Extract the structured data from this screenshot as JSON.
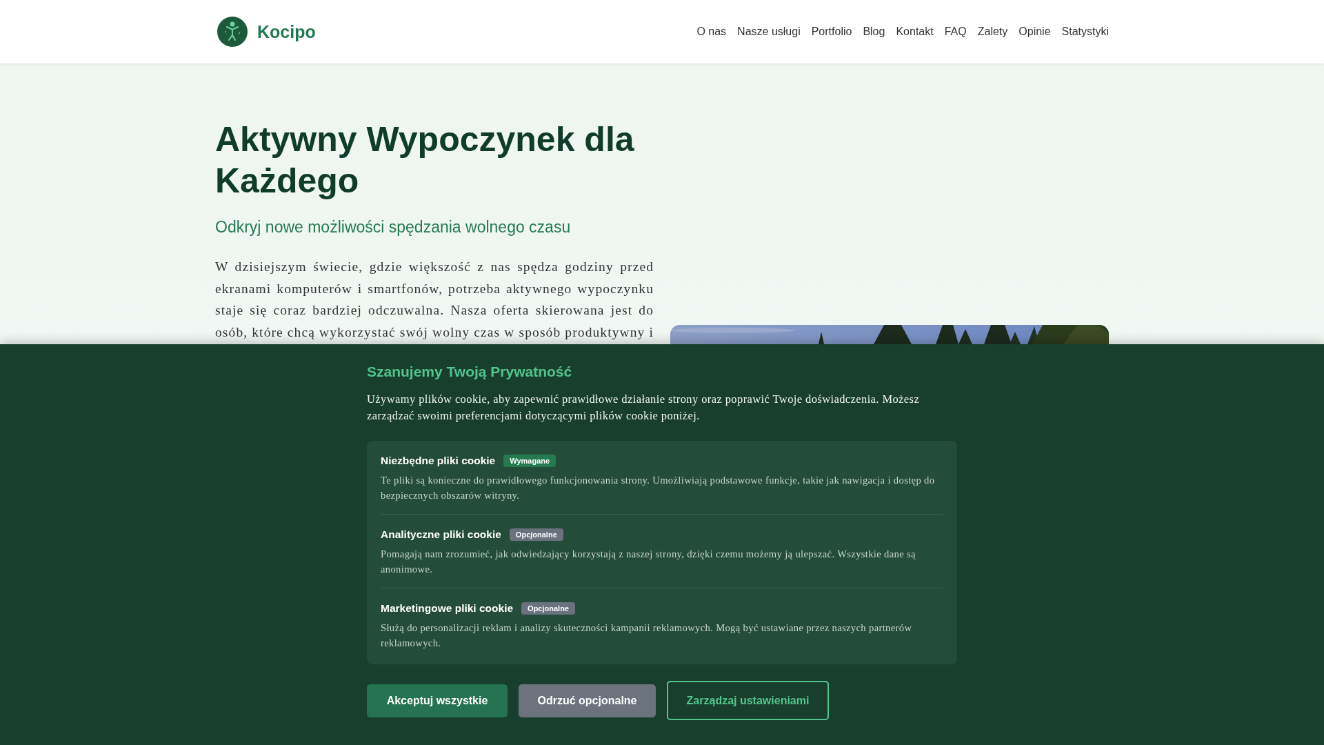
{
  "header": {
    "brand": "Kocipo",
    "nav": [
      {
        "label": "O nas"
      },
      {
        "label": "Nasze usługi"
      },
      {
        "label": "Portfolio"
      },
      {
        "label": "Blog"
      },
      {
        "label": "Kontakt"
      },
      {
        "label": "FAQ"
      },
      {
        "label": "Zalety"
      },
      {
        "label": "Opinie"
      },
      {
        "label": "Statystyki"
      }
    ]
  },
  "hero": {
    "title": "Aktywny Wypoczynek dla Każdego",
    "subtitle": "Odkryj nowe możliwości spędzania wolnego czasu",
    "paragraph": "W dzisiejszym świecie, gdzie większość z nas spędza godziny przed ekranami komputerów i smartfonów, potrzeba aktywnego wypoczynku staje się coraz bardziej odczuwalna. Nasza oferta skierowana jest do osób, które chcą wykorzystać swój wolny czas w sposób produktywny i"
  },
  "cookie_banner": {
    "title": "Szanujemy Twoją Prywatność",
    "text": "Używamy plików cookie, aby zapewnić prawidłowe działanie strony oraz poprawić Twoje doświadczenia. Możesz zarządzać swoimi preferencjami dotyczącymi plików cookie poniżej.",
    "categories": [
      {
        "name": "Niezbędne pliki cookie",
        "badge": "Wymagane",
        "kind": "required",
        "description": "Te pliki są konieczne do prawidłowego funkcjonowania strony. Umożliwiają podstawowe funkcje, takie jak nawigacja i dostęp do bezpiecznych obszarów witryny."
      },
      {
        "name": "Analityczne pliki cookie",
        "badge": "Opcjonalne",
        "kind": "optional",
        "description": "Pomagają nam zrozumieć, jak odwiedzający korzystają z naszej strony, dzięki czemu możemy ją ulepszać. Wszystkie dane są anonimowe."
      },
      {
        "name": "Marketingowe pliki cookie",
        "badge": "Opcjonalne",
        "kind": "optional",
        "description": "Służą do personalizacji reklam i analizy skuteczności kampanii reklamowych. Mogą być ustawiane przez naszych partnerów reklamowych."
      }
    ],
    "buttons": [
      {
        "label": "Akceptuj wszystkie",
        "kind": "primary"
      },
      {
        "label": "Odrzuć opcjonalne",
        "kind": "secondary"
      },
      {
        "label": "Zarządzaj ustawieniami",
        "kind": "outline"
      }
    ]
  }
}
